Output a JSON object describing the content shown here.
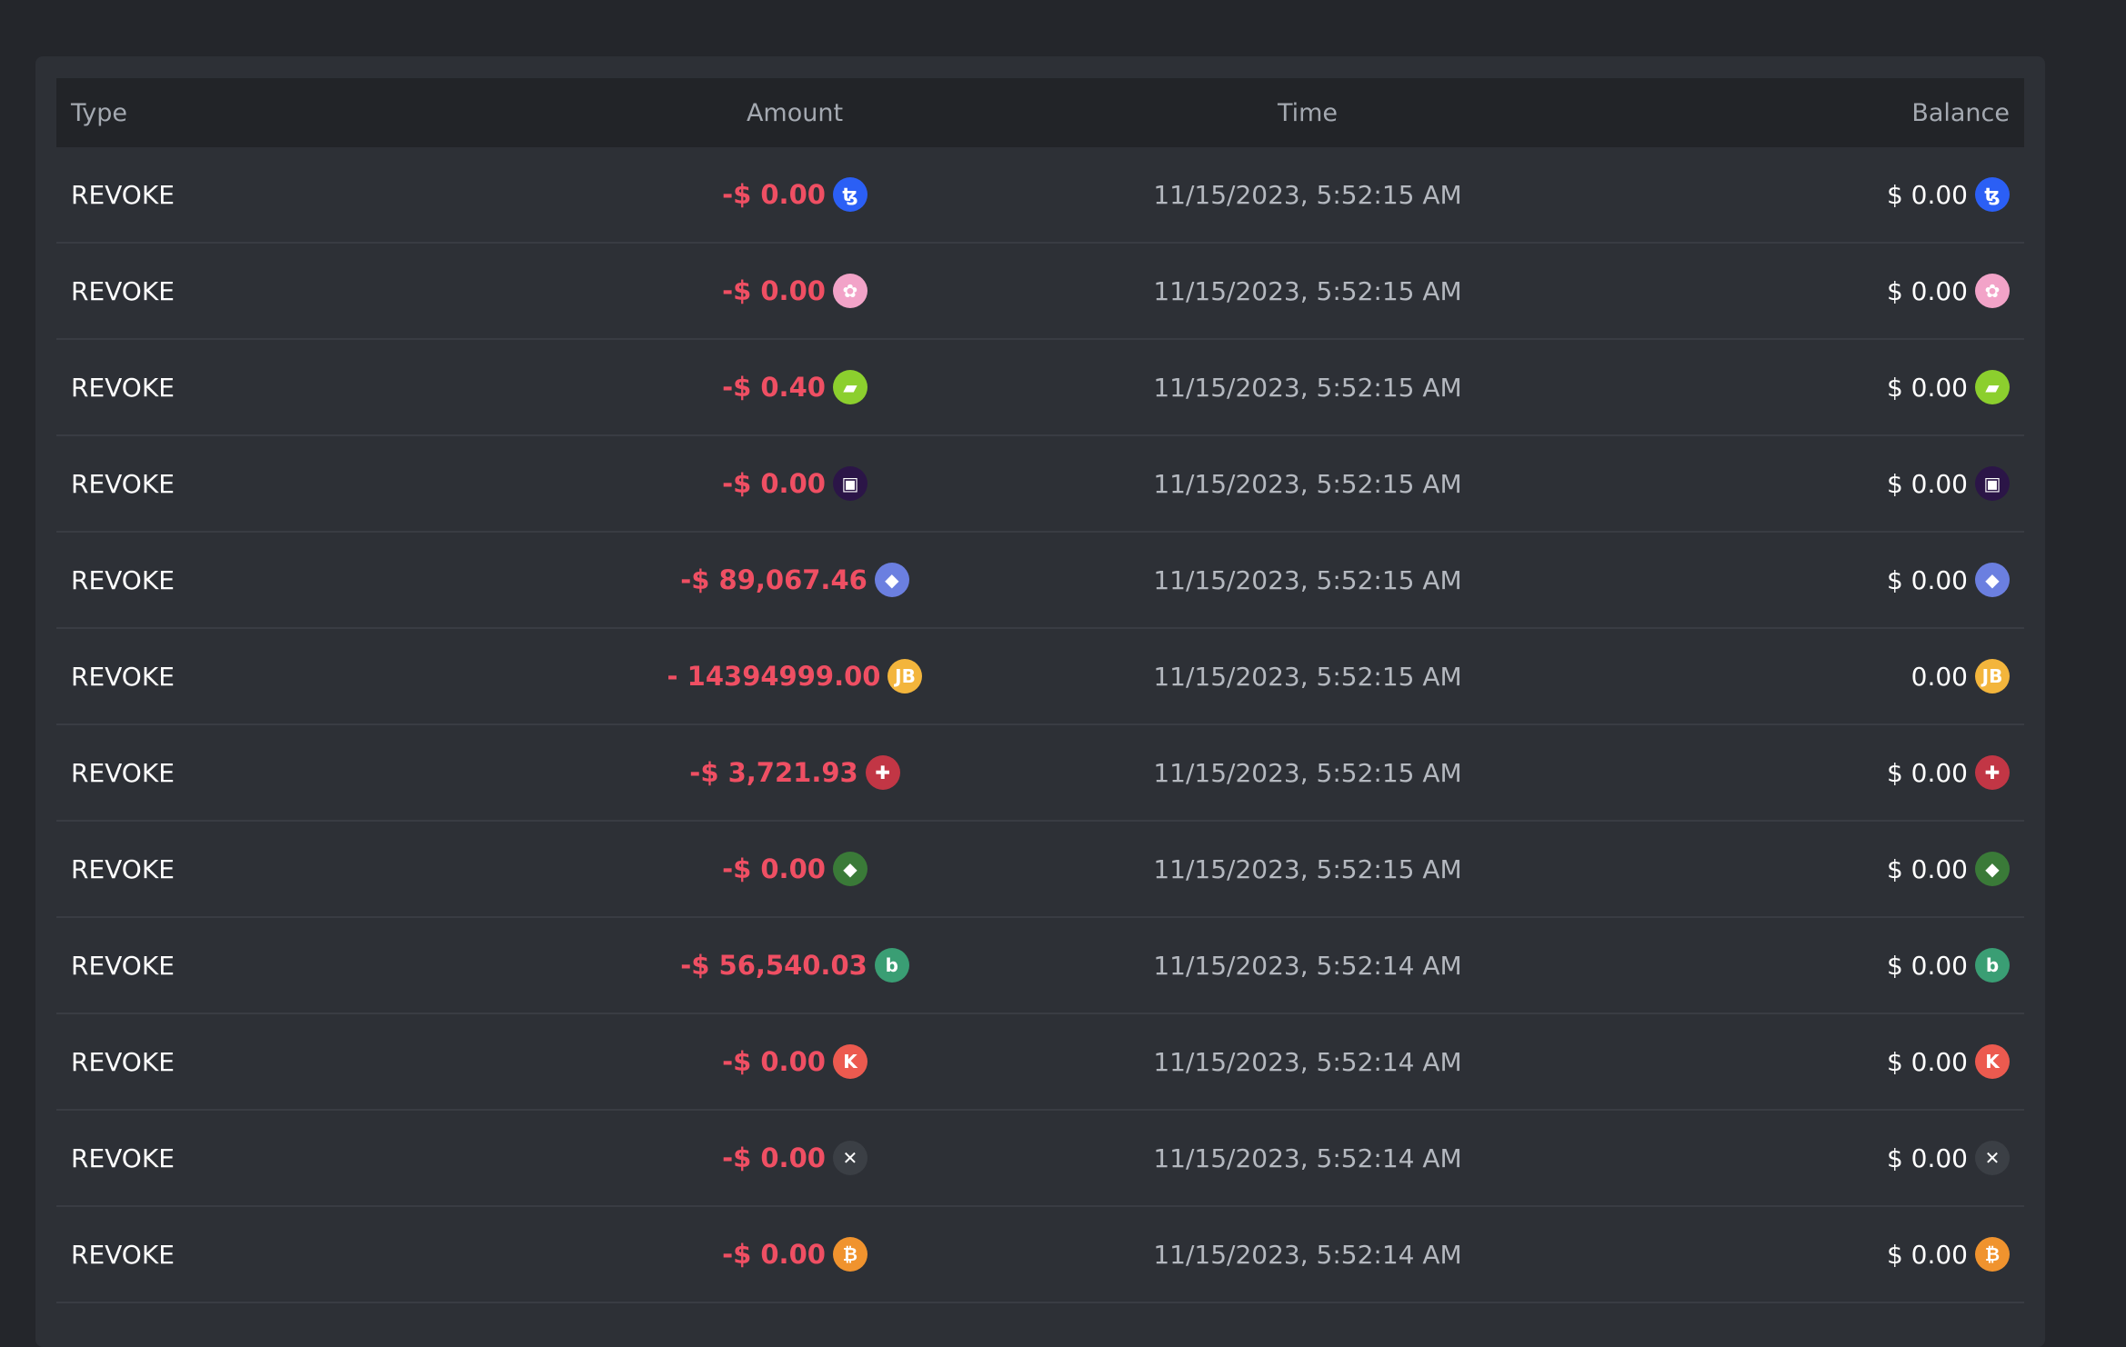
{
  "table": {
    "headers": {
      "type": "Type",
      "amount": "Amount",
      "time": "Time",
      "balance": "Balance"
    },
    "rows": [
      {
        "type": "REVOKE",
        "amount": "-$ 0.00",
        "time": "11/15/2023, 5:52:15 AM",
        "balance": "$ 0.00",
        "icon": "tezos-icon",
        "icon_color": "#2b5ff5",
        "glyph": "ꜩ"
      },
      {
        "type": "REVOKE",
        "amount": "-$ 0.00",
        "time": "11/15/2023, 5:52:15 AM",
        "balance": "$ 0.00",
        "icon": "flower-character-icon",
        "icon_color": "#f2a3c8",
        "glyph": "✿"
      },
      {
        "type": "REVOKE",
        "amount": "-$ 0.40",
        "time": "11/15/2023, 5:52:15 AM",
        "balance": "$ 0.00",
        "icon": "green-ticket-icon",
        "icon_color": "#8ccf2e",
        "glyph": "▰"
      },
      {
        "type": "REVOKE",
        "amount": "-$ 0.00",
        "time": "11/15/2023, 5:52:15 AM",
        "balance": "$ 0.00",
        "icon": "square-frame-icon",
        "icon_color": "#2b1547",
        "glyph": "▣"
      },
      {
        "type": "REVOKE",
        "amount": "-$ 89,067.46",
        "time": "11/15/2023, 5:52:15 AM",
        "balance": "$ 0.00",
        "icon": "ethereum-icon",
        "icon_color": "#6b7fe0",
        "glyph": "◆"
      },
      {
        "type": "REVOKE",
        "amount": "- 14394999.00",
        "time": "11/15/2023, 5:52:15 AM",
        "balance": "0.00",
        "icon": "jb-coin-icon",
        "icon_color": "#f3b53c",
        "glyph": "JB"
      },
      {
        "type": "REVOKE",
        "amount": "-$ 3,721.93",
        "time": "11/15/2023, 5:52:15 AM",
        "balance": "$ 0.00",
        "icon": "red-puzzle-icon",
        "icon_color": "#c23645",
        "glyph": "✚"
      },
      {
        "type": "REVOKE",
        "amount": "-$ 0.00",
        "time": "11/15/2023, 5:52:15 AM",
        "balance": "$ 0.00",
        "icon": "ethereum-classic-icon",
        "icon_color": "#3a7a38",
        "glyph": "◆"
      },
      {
        "type": "REVOKE",
        "amount": "-$ 56,540.03",
        "time": "11/15/2023, 5:52:14 AM",
        "balance": "$ 0.00",
        "icon": "b-coin-icon",
        "icon_color": "#3a9e74",
        "glyph": "b"
      },
      {
        "type": "REVOKE",
        "amount": "-$ 0.00",
        "time": "11/15/2023, 5:52:14 AM",
        "balance": "$ 0.00",
        "icon": "k-coin-icon",
        "icon_color": "#ec5a4f",
        "glyph": "K"
      },
      {
        "type": "REVOKE",
        "amount": "-$ 0.00",
        "time": "11/15/2023, 5:52:14 AM",
        "balance": "$ 0.00",
        "icon": "pirate-character-icon",
        "icon_color": "#3b3f45",
        "glyph": "✕"
      },
      {
        "type": "REVOKE",
        "amount": "-$ 0.00",
        "time": "11/15/2023, 5:52:14 AM",
        "balance": "$ 0.00",
        "icon": "bitcoin-icon",
        "icon_color": "#f0932e",
        "glyph": "₿"
      }
    ]
  }
}
